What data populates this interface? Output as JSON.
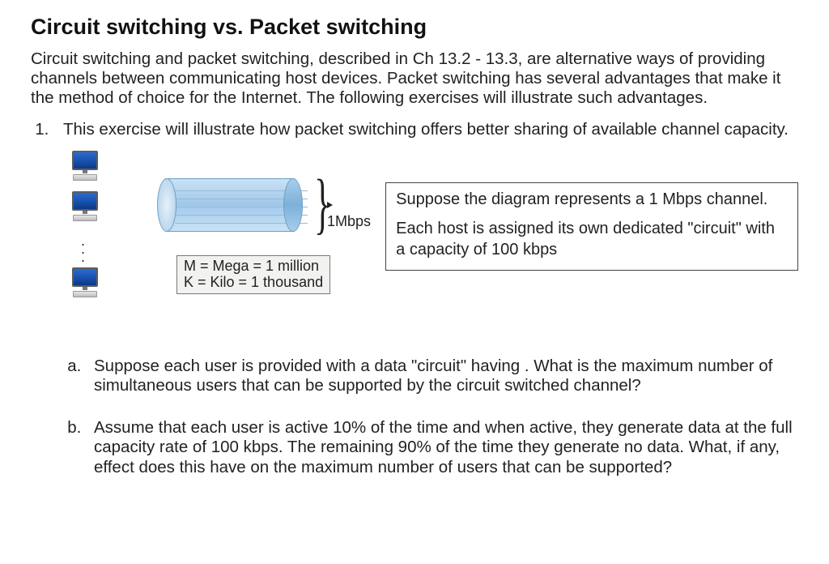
{
  "title": "Circuit switching vs. Packet switching",
  "intro": "Circuit switching and packet switching, described in Ch 13.2 - 13.3, are alternative ways of providing channels between communicating host devices. Packet switching has several advantages that make it the method of choice for the Internet. The following exercises will illustrate such advantages.",
  "q1_text": "This exercise will illustrate how packet switching offers better sharing of available channel capacity.",
  "diagram": {
    "channel_label": "1Mbps",
    "units_line1": "M = Mega = 1 million",
    "units_line2": "K = Kilo = 1 thousand"
  },
  "infobox": {
    "line1": "Suppose the diagram represents a 1 Mbps channel.",
    "line2": "Each host is assigned its own dedicated \"circuit\" with a capacity of 100 kbps"
  },
  "qa_text": "Suppose each user is provided with a data \"circuit\" having . What is the maximum number of simultaneous users that can be supported by the circuit switched channel?",
  "qb_text": "Assume that each user is active 10% of the time and when active, they generate data at the full capacity rate of 100 kbps. The remaining 90% of the time they generate no data. What, if any, effect does this have on the maximum number of users that can be supported?"
}
